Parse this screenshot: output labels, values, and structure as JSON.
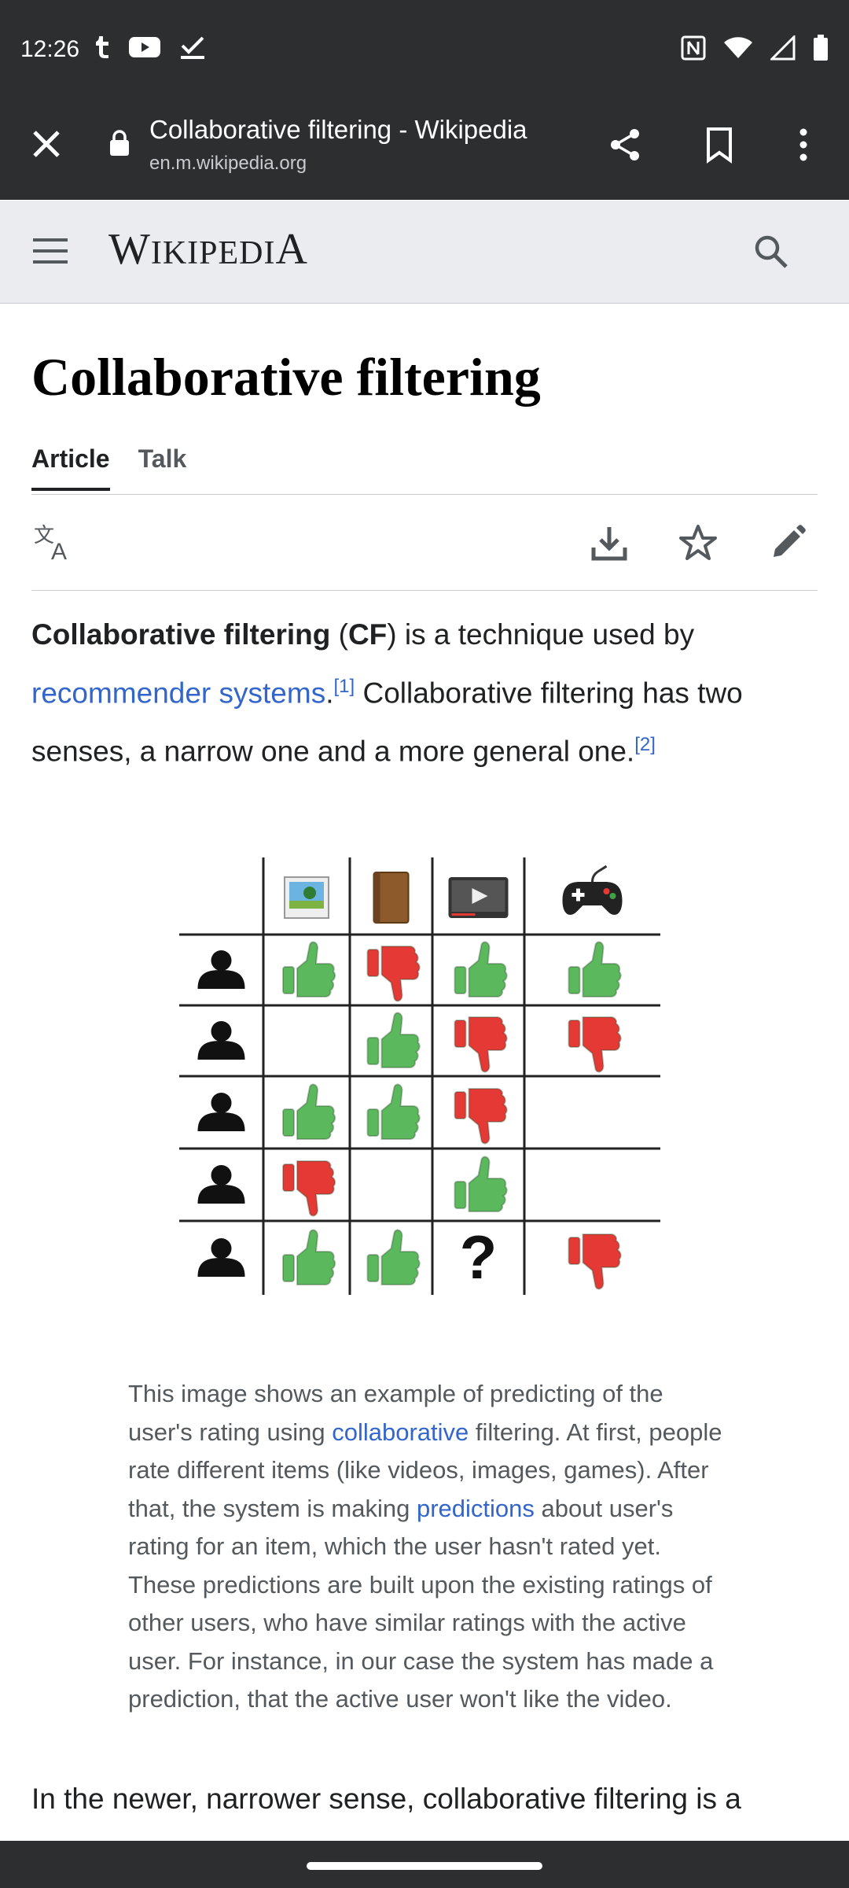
{
  "status_bar": {
    "time": "12:26",
    "left_icons": [
      "tumblr-icon",
      "youtube-icon",
      "check-icon"
    ],
    "right_icons": [
      "nfc-icon",
      "wifi-icon",
      "signal-icon",
      "battery-icon"
    ]
  },
  "browser_toolbar": {
    "title": "Collaborative filtering - Wikipedia",
    "url": "en.m.wikipedia.org"
  },
  "wiki_header": {
    "logo": "Wikipedia"
  },
  "page": {
    "title": "Collaborative filtering",
    "tabs": [
      {
        "label": "Article",
        "active": true
      },
      {
        "label": "Talk",
        "active": false
      }
    ]
  },
  "intro": {
    "bold_term": "Collaborative filtering",
    "paren_open": " (",
    "bold_abbr": "CF",
    "text_1": ") is a technique used by ",
    "link_1": "recommender systems",
    "text_2": ".",
    "ref_1": "[1]",
    "text_3": " Collaborative filtering has two senses, a narrow one and a more general one.",
    "ref_2": "[2]"
  },
  "figure": {
    "item_icons": [
      "image-icon",
      "book-icon",
      "video-icon",
      "gamepad-icon"
    ],
    "ratings": [
      [
        "up",
        "down",
        "up",
        "up"
      ],
      [
        "",
        "up",
        "down",
        "down"
      ],
      [
        "up",
        "up",
        "down",
        ""
      ],
      [
        "down",
        "",
        "up",
        ""
      ],
      [
        "up",
        "up",
        "?",
        "down"
      ]
    ],
    "unknown_symbol": "?",
    "colors": {
      "up": "#5cb85c",
      "down": "#e53935"
    }
  },
  "caption": {
    "text_1": "This image shows an example of predicting of the user's rating using ",
    "link_1": "collaborative",
    "text_2": " filtering. At first, people rate different items (like videos, images, games). After that, the system is making ",
    "link_2": "predictions",
    "text_3": " about user's rating for an item, which the user hasn't rated yet. These predictions are built upon the existing ratings of other users, who have similar ratings with the active user. For instance, in our case the system has made a prediction, that the active user won't like the video."
  },
  "bottom_text": "In the newer, narrower sense, collaborative filtering is a"
}
